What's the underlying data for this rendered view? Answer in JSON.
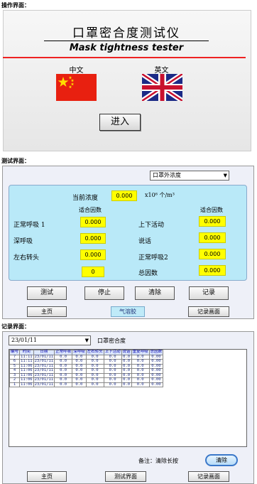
{
  "captions": {
    "p1": "操作界面：",
    "p2": "测试界面：",
    "p3": "记录界面："
  },
  "splash": {
    "title_cn": "口罩密合度测试仪",
    "title_en": "Mask tightness tester",
    "lang_cn": "中文",
    "lang_en": "英文",
    "enter_label": "进入"
  },
  "test": {
    "dropdown_value": "口罩外浓度",
    "conc_label": "当前浓度",
    "conc_value": "0.000",
    "conc_unit": "x10⁶ 个/m³",
    "fit_label_left": "适合因数",
    "fit_label_right": "适合因数",
    "left_items": [
      {
        "label": "正常呼吸 1",
        "value": "0.000"
      },
      {
        "label": "深呼吸",
        "value": "0.000"
      },
      {
        "label": "左右转头",
        "value": "0.000"
      }
    ],
    "right_items": [
      {
        "label": "上下活动",
        "value": "0.000"
      },
      {
        "label": "说话",
        "value": "0.000"
      },
      {
        "label": "正常呼吸2",
        "value": "0.000"
      },
      {
        "label": "总因数",
        "value": "0.000"
      }
    ],
    "counter_value": "0",
    "buttons": {
      "test": "测试",
      "stop": "停止",
      "clear": "清除",
      "record": "记录"
    },
    "nav": {
      "home": "主页",
      "aerosol": "气溶胶",
      "record_screen": "记录画面"
    }
  },
  "record": {
    "date_value": "23/01/11",
    "tag": "口罩密合度",
    "columns": [
      "编号",
      "时间",
      "日期",
      "正常呼吸",
      "深呼吸",
      "左右转头",
      "上下活动",
      "说话",
      "重复呼吸",
      "总因数"
    ],
    "rows": [
      [
        "7",
        "11:11",
        "23/01/11",
        "0.0",
        "0.0",
        "0.0",
        "0.0",
        "0.0",
        "0.0",
        "0.00"
      ],
      [
        "6",
        "11:11",
        "23/01/11",
        "0.0",
        "0.0",
        "0.0",
        "0.0",
        "0.0",
        "0.0",
        "0.00"
      ],
      [
        "5",
        "11:06",
        "23/01/11",
        "0.0",
        "0.0",
        "0.0",
        "0.0",
        "0.0",
        "0.0",
        "0.00"
      ],
      [
        "4",
        "11:06",
        "23/01/11",
        "0.0",
        "0.0",
        "0.0",
        "0.0",
        "0.0",
        "0.0",
        "0.00"
      ],
      [
        "3",
        "11:06",
        "23/01/11",
        "0.0",
        "0.0",
        "0.0",
        "0.0",
        "0.0",
        "0.0",
        "0.00"
      ],
      [
        "2",
        "11:06",
        "23/01/11",
        "0.0",
        "0.0",
        "0.0",
        "0.0",
        "0.0",
        "0.0",
        "0.00"
      ],
      [
        "1",
        "11:06",
        "23/01/11",
        "0.0",
        "0.0",
        "0.0",
        "0.0",
        "0.0",
        "0.0",
        "0.00"
      ]
    ],
    "note": "备注：清除长按",
    "clear_label": "清除",
    "nav": {
      "home": "主页",
      "test_screen": "测试界面",
      "record_screen": "记录画面"
    }
  },
  "colors": {
    "accent_red": "#ee2222",
    "highlight_yellow": "#ffff00",
    "panel_cyan": "#b9e9f8"
  }
}
